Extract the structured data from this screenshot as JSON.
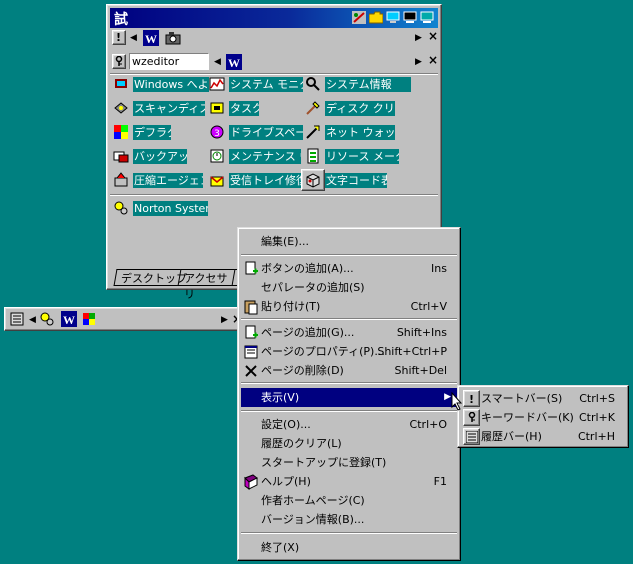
{
  "window": {
    "title_glyph": "試",
    "row1": {
      "bang": "!"
    },
    "row2": {
      "input_value": "wzeditor"
    },
    "close": "×",
    "items": [
      "Windows へようこそ",
      "システム モニタ",
      "システム情報",
      "スキャンディスク",
      "タスク",
      "ディスク クリーンアップ",
      "デフラグ",
      "ドライブスペース",
      "ネット ウォッチャ",
      "バックアップ",
      "メンテナンス ウィザード",
      "リソース メーター",
      "圧縮エージェント",
      "受信トレイ修復ツール",
      "文字コード表",
      "Norton System Doctor"
    ],
    "tabs": [
      "デスクトップ",
      "アクセサリ",
      "シ"
    ]
  },
  "mini_toolbar": {
    "close": "×"
  },
  "context_menu": {
    "items": [
      {
        "label": "編集(E)...",
        "shortcut": ""
      },
      {
        "label": "ボタンの追加(A)...",
        "shortcut": "Ins"
      },
      {
        "label": "セパレータの追加(S)",
        "shortcut": ""
      },
      {
        "label": "貼り付け(T)",
        "shortcut": "Ctrl+V"
      },
      {
        "label": "ページの追加(G)...",
        "shortcut": "Shift+Ins"
      },
      {
        "label": "ページのプロパティ(P)...",
        "shortcut": "Shift+Ctrl+P"
      },
      {
        "label": "ページの削除(D)",
        "shortcut": "Shift+Del"
      },
      {
        "label": "表示(V)",
        "shortcut": ""
      },
      {
        "label": "設定(O)...",
        "shortcut": "Ctrl+O"
      },
      {
        "label": "履歴のクリア(L)",
        "shortcut": ""
      },
      {
        "label": "スタートアップに登録(T)",
        "shortcut": ""
      },
      {
        "label": "ヘルプ(H)",
        "shortcut": "F1"
      },
      {
        "label": "作者ホームページ(C)",
        "shortcut": ""
      },
      {
        "label": "バージョン情報(B)...",
        "shortcut": ""
      },
      {
        "label": "終了(X)",
        "shortcut": ""
      }
    ]
  },
  "submenu": {
    "items": [
      {
        "label": "スマートバー(S)",
        "shortcut": "Ctrl+S"
      },
      {
        "label": "キーワードバー(K)",
        "shortcut": "Ctrl+K"
      },
      {
        "label": "履歴バー(H)",
        "shortcut": "Ctrl+H"
      }
    ]
  },
  "colors": {
    "desktop": "#008080",
    "face": "#c0c0c0",
    "selection": "#000080"
  }
}
